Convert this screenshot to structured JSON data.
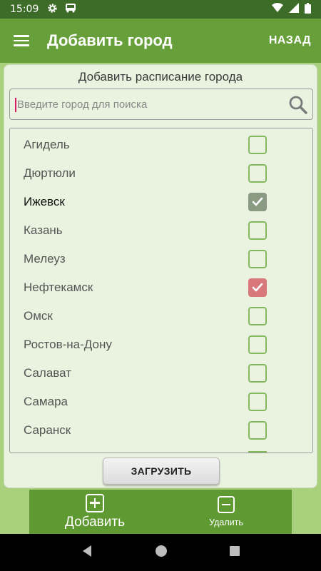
{
  "status_bar": {
    "time": "15:09",
    "icons_left": [
      "gear-icon",
      "bus-icon"
    ],
    "icons_right": [
      "wifi-icon",
      "signal-icon",
      "battery-icon"
    ]
  },
  "app_bar": {
    "title": "Добавить город",
    "back_label": "НАЗАД",
    "background": "#67a03b"
  },
  "card": {
    "title": "Добавить расписание города",
    "search": {
      "placeholder": "Введите город для поиска",
      "value": ""
    },
    "cities": [
      {
        "name": "Агидель",
        "checked": false
      },
      {
        "name": "Дюртюли",
        "checked": false
      },
      {
        "name": "Ижевск",
        "checked": true,
        "state": "grey"
      },
      {
        "name": "Казань",
        "checked": false
      },
      {
        "name": "Мелеуз",
        "checked": false
      },
      {
        "name": "Нефтекамск",
        "checked": true,
        "state": "red"
      },
      {
        "name": "Омск",
        "checked": false
      },
      {
        "name": "Ростов-на-Дону",
        "checked": false
      },
      {
        "name": "Салават",
        "checked": false
      },
      {
        "name": "Самара",
        "checked": false
      },
      {
        "name": "Саранск",
        "checked": false
      }
    ],
    "load_button": "ЗАГРУЗИТЬ"
  },
  "bottom_nav": {
    "add_label": "Добавить",
    "remove_label": "Удалить"
  },
  "colors": {
    "accent": "#67a03b",
    "checkbox_border": "#86b860",
    "checked_grey": "#8a9a83",
    "checked_red": "#d9787a"
  }
}
